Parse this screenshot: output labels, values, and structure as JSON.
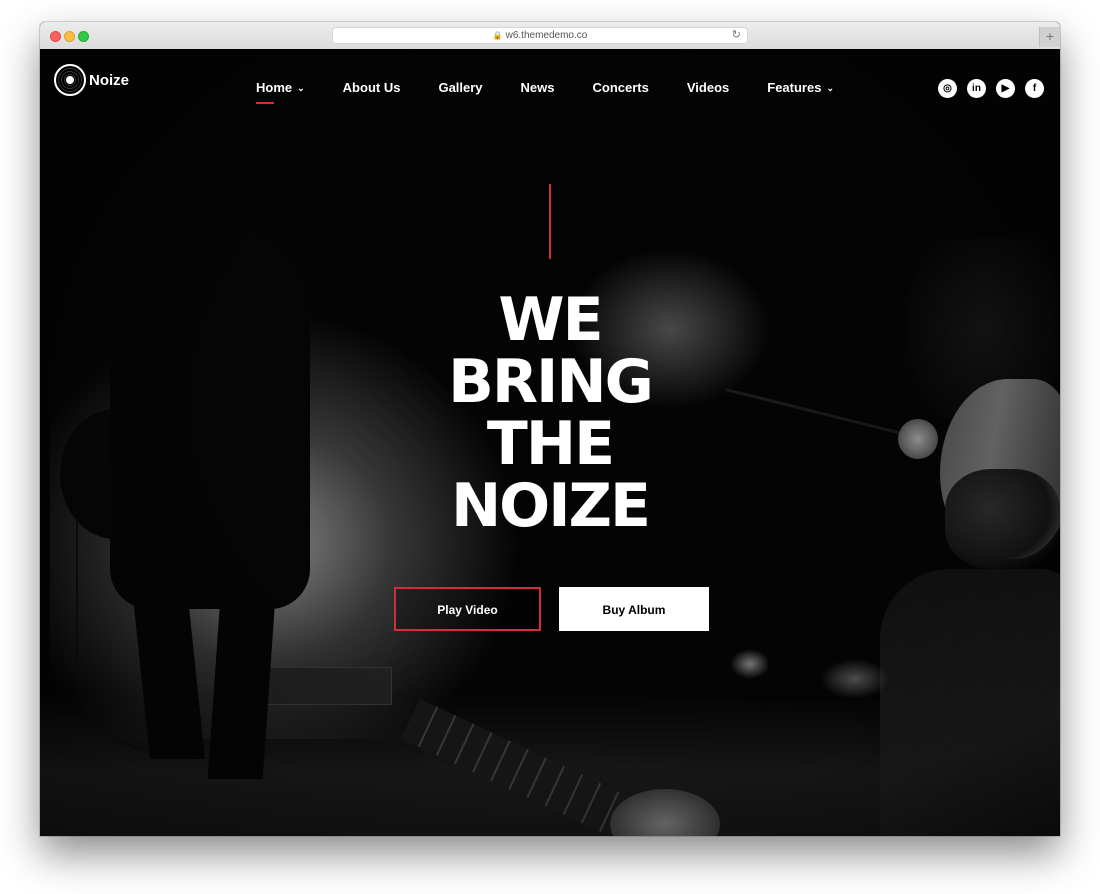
{
  "browser": {
    "url": "w6.themedemo.co",
    "newtab_label": "+",
    "reload_glyph": "↻"
  },
  "site": {
    "logo_text": "Noize"
  },
  "nav": {
    "items": [
      {
        "label": "Home",
        "dropdown": true,
        "active": true
      },
      {
        "label": "About Us",
        "dropdown": false
      },
      {
        "label": "Gallery",
        "dropdown": false
      },
      {
        "label": "News",
        "dropdown": false
      },
      {
        "label": "Concerts",
        "dropdown": false
      },
      {
        "label": "Videos",
        "dropdown": false
      },
      {
        "label": "Features",
        "dropdown": true
      }
    ],
    "chevron": "⌄"
  },
  "social": [
    {
      "icon": "instagram-icon",
      "glyph": "◎"
    },
    {
      "icon": "linkedin-icon",
      "glyph": "in"
    },
    {
      "icon": "youtube-icon",
      "glyph": "▶"
    },
    {
      "icon": "facebook-icon",
      "glyph": "f"
    }
  ],
  "hero": {
    "lines": [
      "WE",
      "BRING",
      "THE",
      "NOIZE"
    ],
    "play_button": "Play Video",
    "buy_button": "Buy Album"
  },
  "colors": {
    "accent": "#d12e3b",
    "background": "#050505",
    "text": "#ffffff"
  }
}
